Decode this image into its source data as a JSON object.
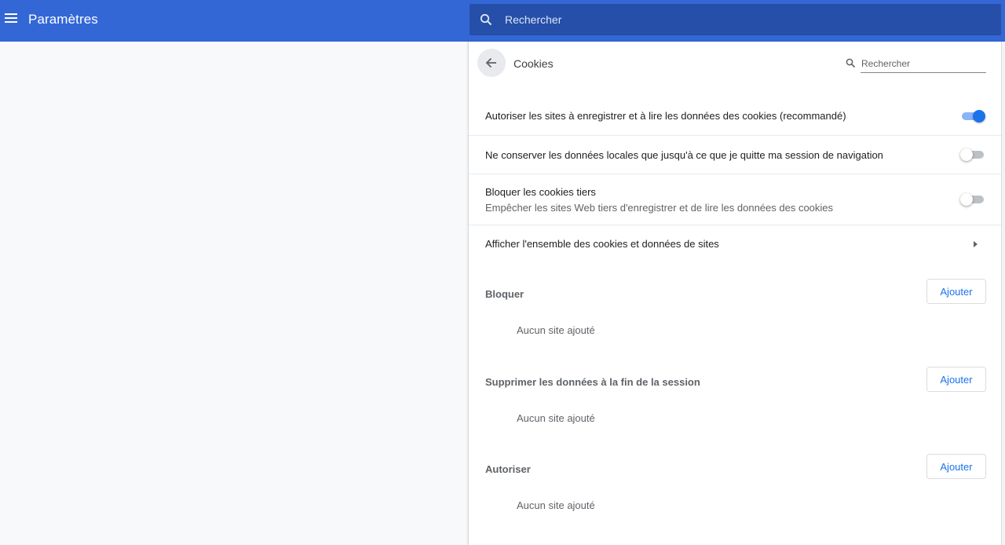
{
  "header": {
    "title": "Paramètres",
    "search_placeholder": "Rechercher"
  },
  "subpage": {
    "title": "Cookies",
    "search_placeholder": "Rechercher"
  },
  "settings": [
    {
      "label": "Autoriser les sites à enregistrer et à lire les données des cookies (recommandé)",
      "toggle": "on"
    },
    {
      "label": "Ne conserver les données locales que jusqu'à ce que je quitte ma session de navigation",
      "toggle": "off"
    },
    {
      "label": "Bloquer les cookies tiers",
      "sublabel": "Empêcher les sites Web tiers d'enregistrer et de lire les données des cookies",
      "toggle": "off"
    },
    {
      "label": "Afficher l'ensemble des cookies et données de sites"
    }
  ],
  "sections": [
    {
      "title": "Bloquer",
      "button": "Ajouter",
      "empty": "Aucun site ajouté"
    },
    {
      "title": "Supprimer les données à la fin de la session",
      "button": "Ajouter",
      "empty": "Aucun site ajouté"
    },
    {
      "title": "Autoriser",
      "button": "Ajouter",
      "empty": "Aucun site ajouté"
    }
  ],
  "colors": {
    "header_bg": "#3367d6",
    "search_bg": "#254fa8",
    "accent": "#1a73e8"
  }
}
